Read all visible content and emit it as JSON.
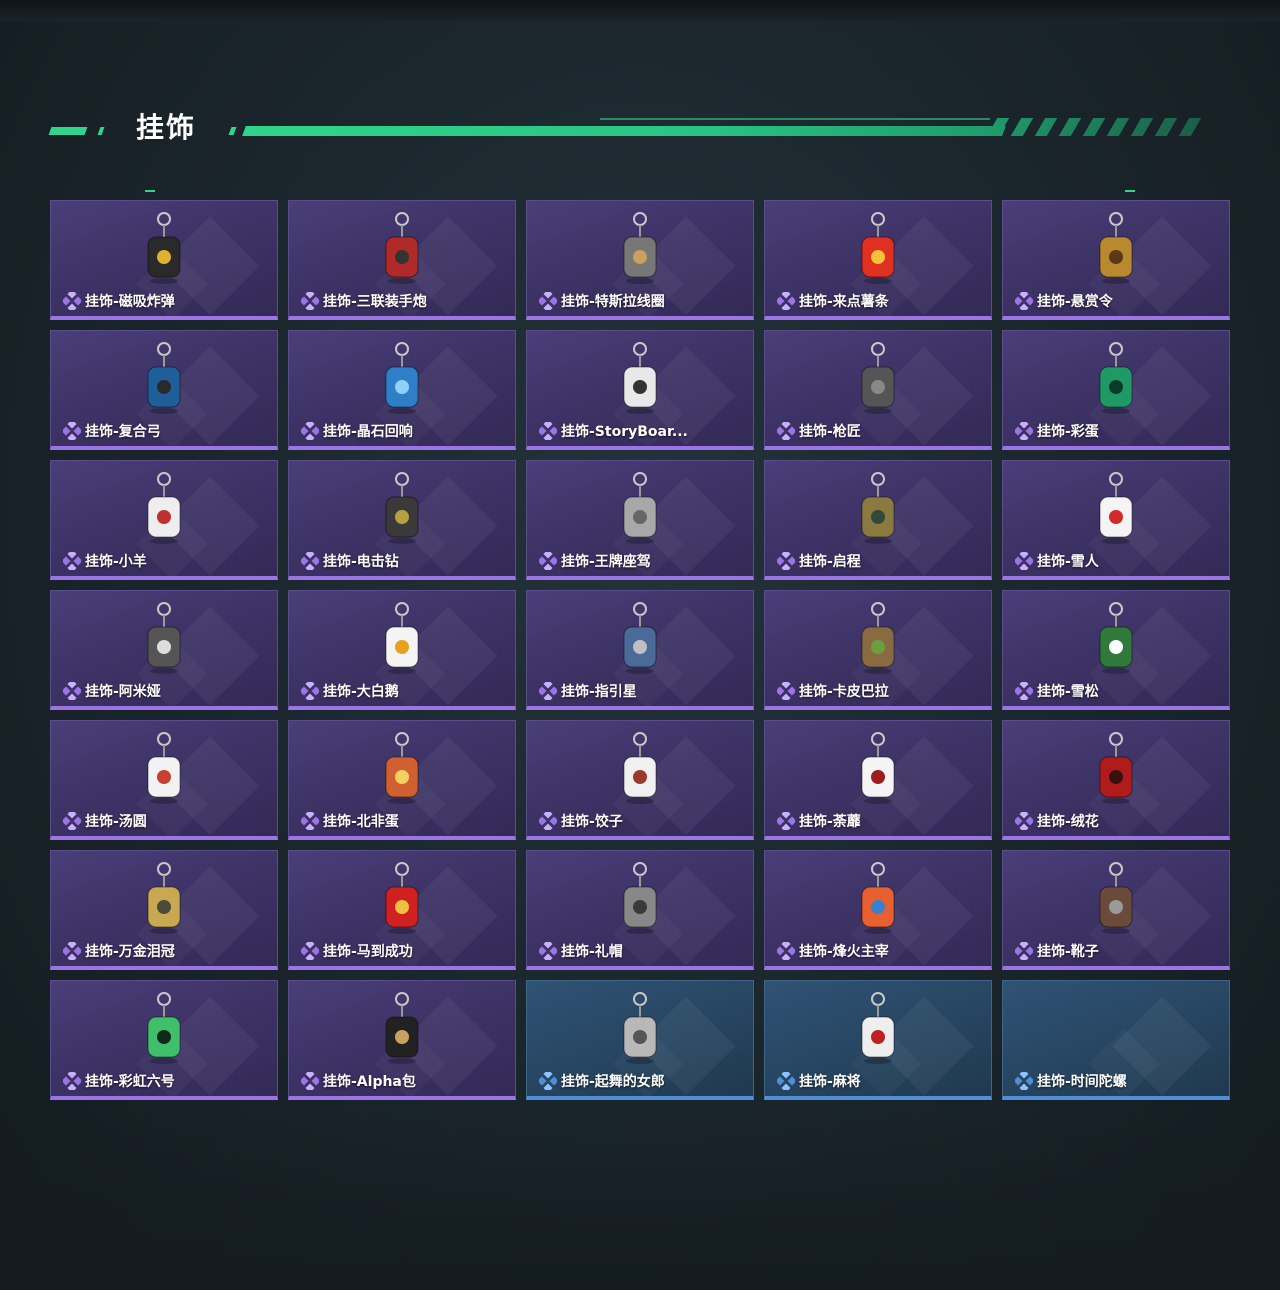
{
  "section": {
    "title": "挂饰"
  },
  "colors": {
    "accent_green": "#2fd58a",
    "card_purple": "#3b3163",
    "card_purple_border": "#9b74e6",
    "card_blue": "#264561",
    "card_blue_border": "#4f8fd6"
  },
  "items": [
    {
      "label": "挂饰-磁吸炸弹",
      "rarity": "purple",
      "icon": "bomb-charm-icon",
      "tint": "#2a2a2a",
      "accent": "#e0b030"
    },
    {
      "label": "挂饰-三联装手炮",
      "rarity": "purple",
      "icon": "hand-cannon-charm-icon",
      "tint": "#b02a2a",
      "accent": "#333333"
    },
    {
      "label": "挂饰-特斯拉线圈",
      "rarity": "purple",
      "icon": "tesla-coil-charm-icon",
      "tint": "#777777",
      "accent": "#c8a060"
    },
    {
      "label": "挂饰-来点薯条",
      "rarity": "purple",
      "icon": "fries-charm-icon",
      "tint": "#e03020",
      "accent": "#f3c23a"
    },
    {
      "label": "挂饰-悬赏令",
      "rarity": "purple",
      "icon": "wanted-poster-charm-icon",
      "tint": "#b9892f",
      "accent": "#5a3a15"
    },
    {
      "label": "挂饰-复合弓",
      "rarity": "purple",
      "icon": "bow-charm-icon",
      "tint": "#1e5f9a",
      "accent": "#2a2a2a"
    },
    {
      "label": "挂饰-晶石回响",
      "rarity": "purple",
      "icon": "crystal-charm-icon",
      "tint": "#2f7fc8",
      "accent": "#8fd0ff"
    },
    {
      "label": "挂饰-StoryBoar...",
      "rarity": "purple",
      "icon": "photo-card-charm-icon",
      "tint": "#e8e8e8",
      "accent": "#333333"
    },
    {
      "label": "挂饰-枪匠",
      "rarity": "purple",
      "icon": "workbench-charm-icon",
      "tint": "#555555",
      "accent": "#888888"
    },
    {
      "label": "挂饰-彩蛋",
      "rarity": "purple",
      "icon": "triangle-egg-charm-icon",
      "tint": "#1f9a66",
      "accent": "#0c3a28"
    },
    {
      "label": "挂饰-小羊",
      "rarity": "purple",
      "icon": "sheep-charm-icon",
      "tint": "#eeeeee",
      "accent": "#c03030"
    },
    {
      "label": "挂饰-电击钻",
      "rarity": "purple",
      "icon": "drill-charm-icon",
      "tint": "#3a3a3a",
      "accent": "#b8a040"
    },
    {
      "label": "挂饰-王牌座驾",
      "rarity": "purple",
      "icon": "jet-charm-icon",
      "tint": "#a8a8a8",
      "accent": "#666666"
    },
    {
      "label": "挂饰-启程",
      "rarity": "purple",
      "icon": "compass-medal-charm-icon",
      "tint": "#8a7a40",
      "accent": "#2f4a3a"
    },
    {
      "label": "挂饰-雪人",
      "rarity": "purple",
      "icon": "snowman-charm-icon",
      "tint": "#f4f4f4",
      "accent": "#d02a2a"
    },
    {
      "label": "挂饰-阿米娅",
      "rarity": "purple",
      "icon": "bunny-charm-icon",
      "tint": "#555555",
      "accent": "#dddddd"
    },
    {
      "label": "挂饰-大白鹅",
      "rarity": "purple",
      "icon": "goose-charm-icon",
      "tint": "#f4f4f4",
      "accent": "#e8a020"
    },
    {
      "label": "挂饰-指引星",
      "rarity": "purple",
      "icon": "compass-charm-icon",
      "tint": "#4a6a9a",
      "accent": "#c0c0c0"
    },
    {
      "label": "挂饰-卡皮巴拉",
      "rarity": "purple",
      "icon": "capybara-charm-icon",
      "tint": "#8a6a40",
      "accent": "#6aa040"
    },
    {
      "label": "挂饰-雪松",
      "rarity": "purple",
      "icon": "pine-tree-charm-icon",
      "tint": "#2f7a3a",
      "accent": "#ffffff"
    },
    {
      "label": "挂饰-汤圆",
      "rarity": "purple",
      "icon": "dumpling-bowl-charm-icon",
      "tint": "#f2f2f2",
      "accent": "#c84030"
    },
    {
      "label": "挂饰-北非蛋",
      "rarity": "purple",
      "icon": "shakshuka-charm-icon",
      "tint": "#d06030",
      "accent": "#f4d060"
    },
    {
      "label": "挂饰-饺子",
      "rarity": "purple",
      "icon": "jiaozi-plate-charm-icon",
      "tint": "#f0f0f0",
      "accent": "#9a3a2a"
    },
    {
      "label": "挂饰-荼蘼",
      "rarity": "purple",
      "icon": "white-flower-charm-icon",
      "tint": "#f4f4f4",
      "accent": "#a01c1c"
    },
    {
      "label": "挂饰-绒花",
      "rarity": "purple",
      "icon": "red-flower-charm-icon",
      "tint": "#b01c1c",
      "accent": "#3a1010"
    },
    {
      "label": "挂饰-万金泪冠",
      "rarity": "purple",
      "icon": "golden-crown-charm-icon",
      "tint": "#c8a850",
      "accent": "#4a4a3a"
    },
    {
      "label": "挂饰-马到成功",
      "rarity": "purple",
      "icon": "horse-charm-icon",
      "tint": "#d02020",
      "accent": "#f0c040"
    },
    {
      "label": "挂饰-礼帽",
      "rarity": "purple",
      "icon": "fedora-charm-icon",
      "tint": "#888888",
      "accent": "#3a3a3a"
    },
    {
      "label": "挂饰-烽火主宰",
      "rarity": "purple",
      "icon": "graffiti-tag-charm-icon",
      "tint": "#e86030",
      "accent": "#3a80d0"
    },
    {
      "label": "挂饰-靴子",
      "rarity": "purple",
      "icon": "boot-charm-icon",
      "tint": "#6a4a3a",
      "accent": "#9a9a9a"
    },
    {
      "label": "挂饰-彩虹六号",
      "rarity": "purple",
      "icon": "rainbow-six-charm-icon",
      "tint": "#3fbf6a",
      "accent": "#0f2a1a"
    },
    {
      "label": "挂饰-Alpha包",
      "rarity": "purple",
      "icon": "pouch-charm-icon",
      "tint": "#222222",
      "accent": "#c8a060"
    },
    {
      "label": "挂饰-起舞的女郎",
      "rarity": "blue",
      "icon": "dancer-charm-icon",
      "tint": "#b8b8b8",
      "accent": "#555555"
    },
    {
      "label": "挂饰-麻将",
      "rarity": "blue",
      "icon": "mahjong-tile-charm-icon",
      "tint": "#eeeeee",
      "accent": "#c02020"
    },
    {
      "label": "挂饰-时间陀螺",
      "rarity": "blue",
      "icon": "none",
      "tint": "",
      "accent": ""
    }
  ]
}
